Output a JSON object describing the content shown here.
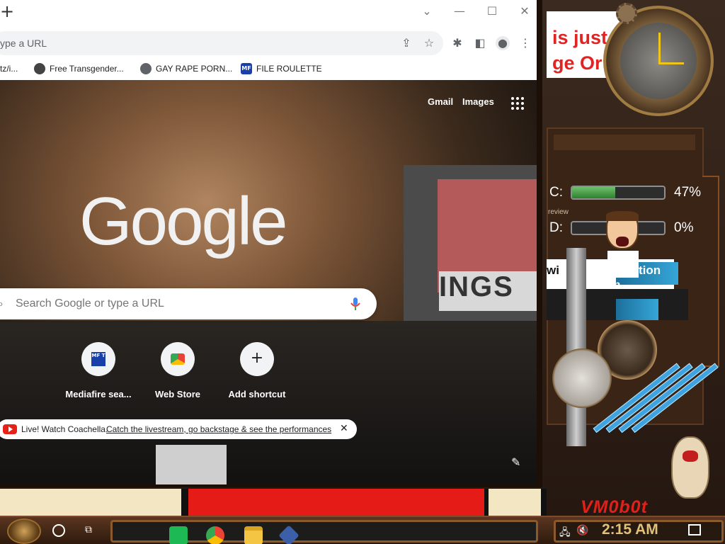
{
  "browser": {
    "new_tab_symbol": "+",
    "window_controls": {
      "dropdown": "⌄",
      "minimize": "—",
      "maximize": "☐",
      "close": "✕"
    },
    "omnibox_placeholder": "ype a URL",
    "bookmarks": [
      {
        "label": "rtz/i...",
        "icon": "page-icon"
      },
      {
        "label": "Free Transgender...",
        "icon": "site-icon"
      },
      {
        "label": "GAY RAPE PORN...",
        "icon": "globe-icon"
      },
      {
        "label": "FILE ROULETTE",
        "icon": "mft-icon"
      }
    ]
  },
  "ntp": {
    "gmail": "Gmail",
    "images": "Images",
    "logo": "Google",
    "search_placeholder": "Search Google or type a URL",
    "shortcuts": [
      {
        "label": "Mediafire sea...",
        "icon_text": "MF T"
      },
      {
        "label": "Web Store",
        "icon_text": ""
      },
      {
        "label": "Add shortcut",
        "icon_text": "+"
      }
    ],
    "promo_prefix": "Live! Watch Coachella.",
    "promo_link": "Catch the livestream, go backstage & see the performances",
    "promo_close": "✕",
    "background_sign": "INGS"
  },
  "desktop": {
    "poster_line1": "is just",
    "poster_line2": "ge Or",
    "drives": [
      {
        "label": "C:",
        "percent_text": "47%",
        "fill": 0.47
      },
      {
        "label": "D:",
        "percent_text": "0%",
        "fill": 0.0
      }
    ],
    "pipe_text_1": "wi",
    "pipe_text_2": "tion",
    "pipe_text_3": "edition",
    "preview_text": "review",
    "hamster_caption": "VM0b0t"
  },
  "taskbar": {
    "time": "2:15 AM",
    "apps": [
      "spotify-icon",
      "chrome-icon",
      "file-explorer-icon",
      "virtualbox-icon"
    ]
  },
  "colors": {
    "poster_red": "#e02424",
    "caption_red": "#e0201a",
    "clock_gold": "#e0c07a",
    "drive_green": "#4fa64f"
  }
}
